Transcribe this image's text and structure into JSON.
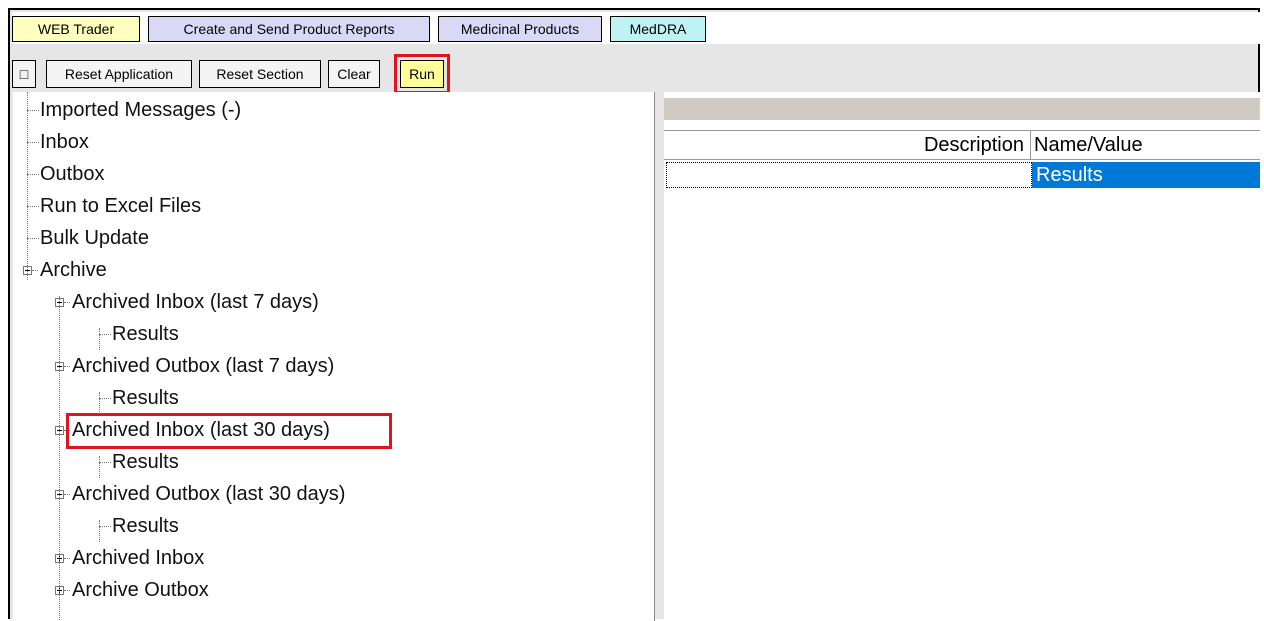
{
  "tabs": [
    {
      "label": "WEB Trader",
      "color": "#ffffbf"
    },
    {
      "label": "Create and Send Product Reports",
      "color": "#d9d9f7"
    },
    {
      "label": "Medicinal Products",
      "color": "#d9d9f7"
    },
    {
      "label": "MedDRA",
      "color": "#bff2f2"
    }
  ],
  "toolbar": {
    "restore_glyph": "□",
    "reset_application": "Reset Application",
    "reset_section": "Reset Section",
    "clear": "Clear",
    "run": "Run"
  },
  "tree": [
    {
      "label": "Imported Messages (-)"
    },
    {
      "label": "Inbox"
    },
    {
      "label": "Outbox"
    },
    {
      "label": "Run to Excel Files"
    },
    {
      "label": "Bulk Update"
    },
    {
      "label": "Archive",
      "expanded": true
    },
    {
      "label": "Archived Inbox (last 7 days)",
      "expanded": true
    },
    {
      "label": "Results"
    },
    {
      "label": "Archived Outbox (last 7 days)",
      "expanded": true
    },
    {
      "label": "Results"
    },
    {
      "label": "Archived Inbox (last 30 days)",
      "expanded": true,
      "highlighted": true
    },
    {
      "label": "Results"
    },
    {
      "label": "Archived Outbox (last 30 days)",
      "expanded": true
    },
    {
      "label": "Results"
    },
    {
      "label": "Archived Inbox",
      "expanded": false
    },
    {
      "label": "Archive Outbox",
      "expanded": false
    }
  ],
  "properties": {
    "columns": [
      "Description",
      "Name/Value"
    ],
    "rows": [
      {
        "description": "",
        "value": "Results"
      }
    ]
  },
  "colors": {
    "highlight": "#e0141e",
    "selection": "#0078d7"
  }
}
